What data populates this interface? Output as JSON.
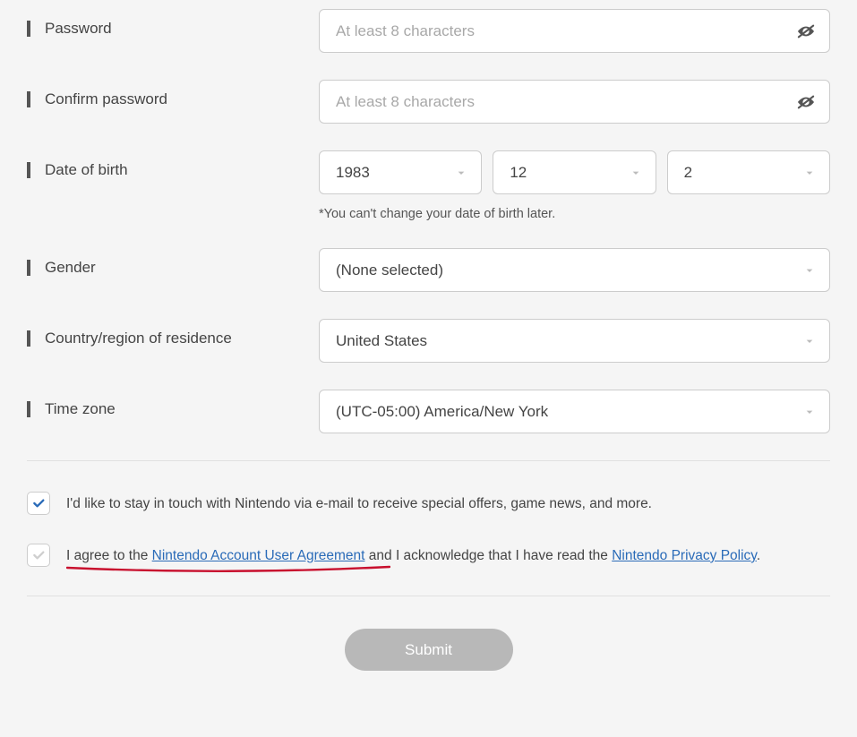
{
  "fields": {
    "password": {
      "label": "Password",
      "placeholder": "At least 8 characters"
    },
    "confirm": {
      "label": "Confirm password",
      "placeholder": "At least 8 characters"
    },
    "dob": {
      "label": "Date of birth",
      "year": "1983",
      "month": "12",
      "day": "2",
      "note": "*You can't change your date of birth later."
    },
    "gender": {
      "label": "Gender",
      "value": "(None selected)"
    },
    "country": {
      "label": "Country/region of residence",
      "value": "United States"
    },
    "tz": {
      "label": "Time zone",
      "value": "(UTC-05:00) America/New York"
    }
  },
  "checks": {
    "newsletter": {
      "checked": true,
      "label": "I'd like to stay in touch with Nintendo via e-mail to receive special offers, game news, and more."
    },
    "agreement": {
      "checked": false,
      "pre": "I agree to the ",
      "link1": "Nintendo Account User Agreement",
      "mid": " and I acknowledge that I have read the ",
      "link2": "Nintendo Privacy Policy",
      "post": "."
    }
  },
  "submit": "Submit"
}
